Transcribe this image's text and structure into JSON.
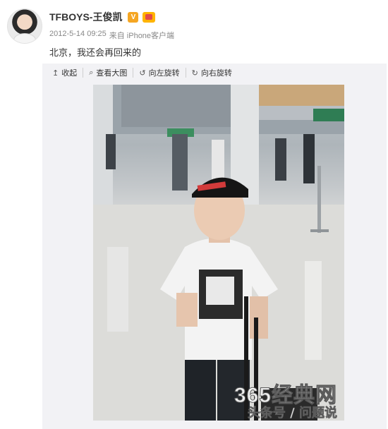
{
  "post": {
    "user_name": "TFBOYS-王俊凯",
    "verified_badge": "V",
    "timestamp": "2012-5-14 09:25",
    "source": "来自 iPhone客户端",
    "text": "北京，我还会再回来的"
  },
  "toolbar": {
    "collapse": {
      "icon": "↥",
      "label": "收起"
    },
    "view_large": {
      "icon": "⌕",
      "label": "查看大图"
    },
    "rotate_left": {
      "icon": "↺",
      "label": "向左旋转"
    },
    "rotate_right": {
      "icon": "↻",
      "label": "向右旋转"
    }
  },
  "watermark": {
    "line1": "365经典网",
    "line2": "头条号 / 问题说"
  },
  "icons": [
    "avatar",
    "verified-badge-icon",
    "member-icon",
    "collapse-icon",
    "search-icon",
    "rotate-left-icon",
    "rotate-right-icon"
  ],
  "colors": {
    "badge": "#f5a623",
    "toolbar_bg": "#f2f2f5",
    "meta_text": "#888888"
  }
}
